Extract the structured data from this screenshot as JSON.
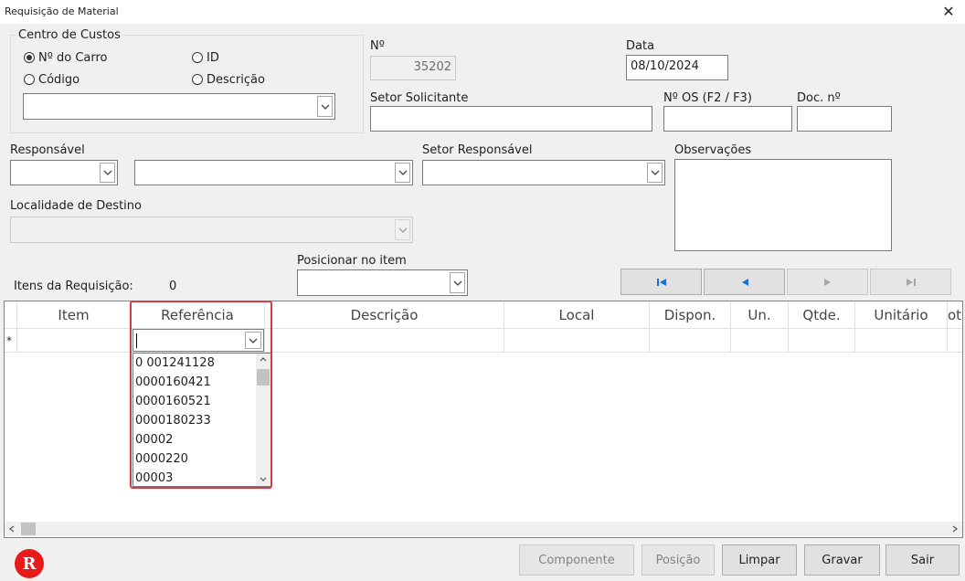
{
  "window": {
    "title": "Requisição de Material"
  },
  "centro_custos": {
    "caption": "Centro de Custos",
    "options": [
      {
        "label": "Nº do Carro",
        "selected": true
      },
      {
        "label": "ID",
        "selected": false
      },
      {
        "label": "Código",
        "selected": false
      },
      {
        "label": "Descrição",
        "selected": false
      }
    ]
  },
  "numero": {
    "label": "Nº",
    "value": "35202"
  },
  "data": {
    "label": "Data",
    "value": "08/10/2024"
  },
  "setor_solicitante": {
    "label": "Setor Solicitante"
  },
  "os": {
    "label": "Nº OS (F2 / F3)"
  },
  "doc": {
    "label": "Doc. nº"
  },
  "responsavel": {
    "label": "Responsável"
  },
  "setor_responsavel": {
    "label": "Setor Responsável"
  },
  "observacoes": {
    "label": "Observações"
  },
  "localidade": {
    "label": "Localidade de Destino"
  },
  "itens": {
    "label": "Itens da Requisição:",
    "count": "0"
  },
  "posicionar": {
    "label": "Posicionar no item"
  },
  "grid": {
    "columns": [
      "Item",
      "Referência",
      "Descrição",
      "Local",
      "Dispon.",
      "Un.",
      "Qtde.",
      "Unitário",
      "ot"
    ],
    "new_row_marker": "*"
  },
  "dropdown": {
    "items": [
      "0 001241128",
      "0000160421",
      "0000160521",
      "0000180233",
      "00002",
      "0000220",
      "00003"
    ]
  },
  "footer": {
    "buttons": [
      "Componente",
      "Posição",
      "Limpar",
      "Gravar",
      "Sair"
    ]
  },
  "logo": {
    "letter": "R"
  },
  "colors": {
    "highlight": "#d93a44",
    "nav_arrow": "#1a6fd1",
    "logo": "#e81b1b"
  }
}
